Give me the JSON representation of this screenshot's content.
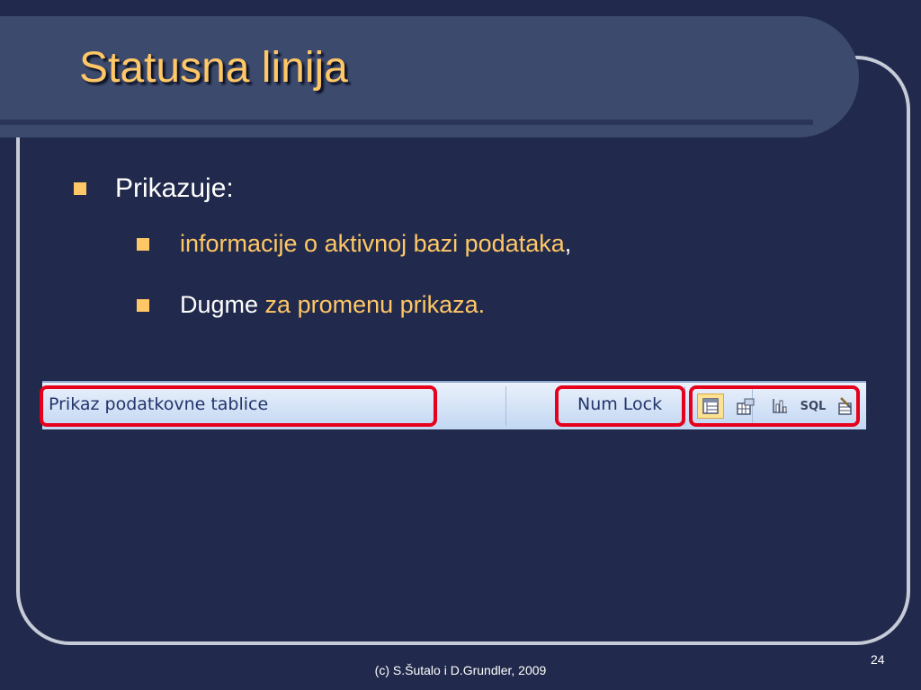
{
  "slide": {
    "title": "Statusna linija",
    "bullets": {
      "main": "Prikazuje:",
      "sub1": {
        "gold": "informacije o aktivnoj bazi podataka",
        "white": ","
      },
      "sub2": {
        "white": "Dugme ",
        "gold": "za promenu prikaza."
      }
    },
    "footer": "(c) S.Šutalo i D.Grundler, 2009",
    "page_number": "24"
  },
  "statusbar": {
    "left_text": "Prikaz podatkovne tablice",
    "right_text": "Num Lock",
    "view_buttons": [
      {
        "name": "datasheet-view-icon",
        "active": true
      },
      {
        "name": "pivot-table-view-icon",
        "active": false
      },
      {
        "name": "pivot-chart-view-icon",
        "active": false
      },
      {
        "name": "sql-view-icon",
        "label": "SQL",
        "active": false
      },
      {
        "name": "design-view-icon",
        "active": false
      }
    ]
  },
  "colors": {
    "background": "#212a4c",
    "accent": "#ffc766",
    "highlight": "#e6001b"
  }
}
